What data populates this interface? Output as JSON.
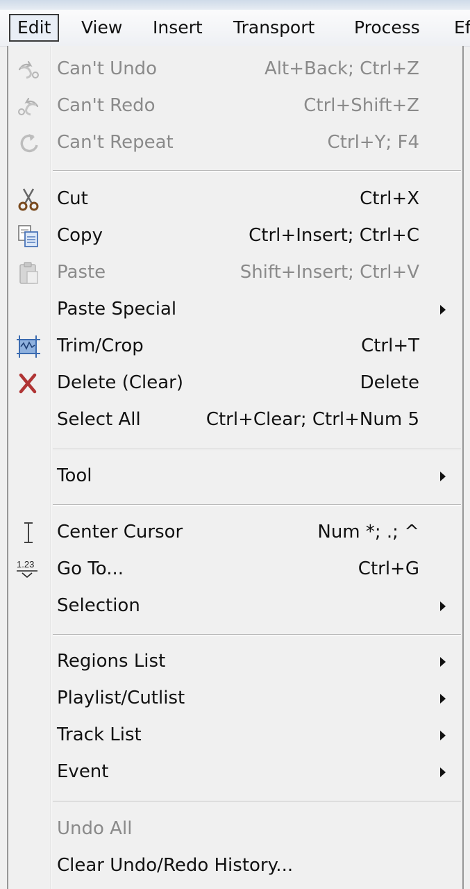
{
  "menubar": {
    "items": [
      "Edit",
      "View",
      "Insert",
      "Transport",
      "Process",
      "Ef"
    ]
  },
  "edit_menu": {
    "groups": [
      [
        {
          "label": "Can't Undo",
          "shortcut": "Alt+Back; Ctrl+Z",
          "disabled": true,
          "icon": "undo-icon"
        },
        {
          "label": "Can't Redo",
          "shortcut": "Ctrl+Shift+Z",
          "disabled": true,
          "icon": "redo-icon"
        },
        {
          "label": "Can't Repeat",
          "shortcut": "Ctrl+Y; F4",
          "disabled": true,
          "icon": "repeat-icon"
        }
      ],
      [
        {
          "label": "Cut",
          "shortcut": "Ctrl+X",
          "disabled": false,
          "icon": "scissors-icon"
        },
        {
          "label": "Copy",
          "shortcut": "Ctrl+Insert; Ctrl+C",
          "disabled": false,
          "icon": "copy-icon"
        },
        {
          "label": "Paste",
          "shortcut": "Shift+Insert; Ctrl+V",
          "disabled": true,
          "icon": "paste-icon"
        },
        {
          "label": "Paste Special",
          "shortcut": "",
          "disabled": false,
          "submenu": true
        },
        {
          "label": "Trim/Crop",
          "shortcut": "Ctrl+T",
          "disabled": false,
          "icon": "trim-crop-icon"
        },
        {
          "label": "Delete (Clear)",
          "shortcut": "Delete",
          "disabled": false,
          "icon": "delete-x-icon"
        },
        {
          "label": "Select All",
          "shortcut": "Ctrl+Clear; Ctrl+Num 5",
          "disabled": false
        }
      ],
      [
        {
          "label": "Tool",
          "shortcut": "",
          "disabled": false,
          "submenu": true
        }
      ],
      [
        {
          "label": "Center Cursor",
          "shortcut": "Num *; .; ^",
          "disabled": false,
          "icon": "text-cursor-icon"
        },
        {
          "label": "Go To...",
          "shortcut": "Ctrl+G",
          "disabled": false,
          "icon": "goto-123-icon"
        },
        {
          "label": "Selection",
          "shortcut": "",
          "disabled": false,
          "submenu": true
        }
      ],
      [
        {
          "label": "Regions List",
          "shortcut": "",
          "disabled": false,
          "submenu": true
        },
        {
          "label": "Playlist/Cutlist",
          "shortcut": "",
          "disabled": false,
          "submenu": true
        },
        {
          "label": "Track List",
          "shortcut": "",
          "disabled": false,
          "submenu": true
        },
        {
          "label": "Event",
          "shortcut": "",
          "disabled": false,
          "submenu": true
        }
      ],
      [
        {
          "label": "Undo All",
          "shortcut": "",
          "disabled": true
        },
        {
          "label": "Clear Undo/Redo History...",
          "shortcut": "",
          "disabled": false
        }
      ]
    ]
  },
  "icons": {
    "undo": "undo-icon",
    "redo": "redo-icon",
    "repeat": "repeat-icon",
    "cut": "scissors-icon",
    "copy": "copy-icon",
    "paste": "paste-icon",
    "trim": "trim-crop-icon",
    "delete": "delete-x-icon",
    "cursor": "text-cursor-icon",
    "goto": "goto-123-icon",
    "goto_text": "1.23"
  },
  "colors": {
    "delete_x": "#b03535",
    "disabled_text": "#8a8a8a",
    "trim_icon": "#4a7fc2"
  }
}
